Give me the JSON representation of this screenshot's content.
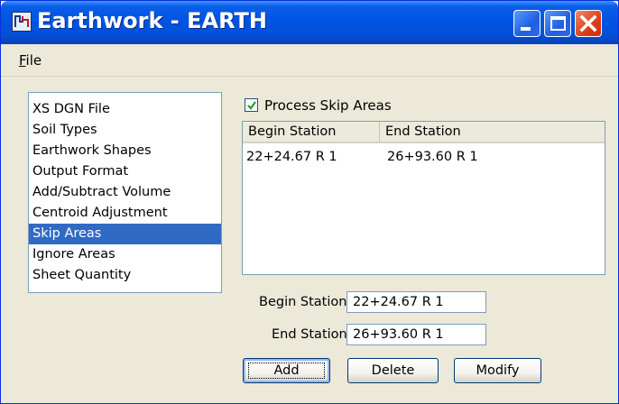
{
  "window": {
    "title": "Earthwork - EARTH",
    "controls": {
      "minimize": "minimize",
      "maximize": "maximize",
      "close": "close"
    }
  },
  "menu": {
    "file_first": "F",
    "file_rest": "ile"
  },
  "nav": {
    "items": [
      {
        "label": "XS DGN File",
        "selected": false
      },
      {
        "label": "Soil Types",
        "selected": false
      },
      {
        "label": "Earthwork Shapes",
        "selected": false
      },
      {
        "label": "Output Format",
        "selected": false
      },
      {
        "label": "Add/Subtract Volume",
        "selected": false
      },
      {
        "label": "Centroid Adjustment",
        "selected": false
      },
      {
        "label": "Skip Areas",
        "selected": true
      },
      {
        "label": "Ignore Areas",
        "selected": false
      },
      {
        "label": "Sheet Quantity",
        "selected": false
      }
    ]
  },
  "skip": {
    "checkbox_label": "Process Skip Areas",
    "checked": true,
    "table": {
      "columns": [
        "Begin Station",
        "End Station"
      ],
      "rows": [
        [
          "22+24.67 R 1",
          "26+93.60 R 1"
        ]
      ]
    },
    "begin_label": "Begin Station:",
    "begin_value": "22+24.67 R 1",
    "end_label": "End Station:",
    "end_value": "26+93.60 R 1"
  },
  "buttons": {
    "add": "Add",
    "delete": "Delete",
    "modify": "Modify"
  },
  "colors": {
    "title_bar": "#0054e3",
    "selection": "#316ac5",
    "window_bg": "#ece9d8"
  }
}
